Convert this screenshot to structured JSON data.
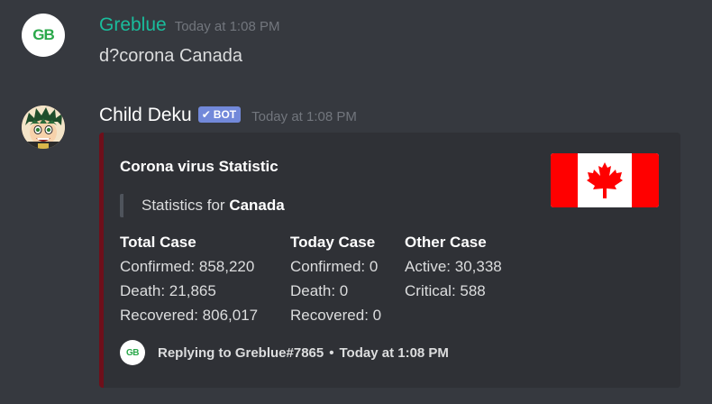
{
  "messages": [
    {
      "username": "Greblue",
      "username_color": "#1abc9c",
      "timestamp": "Today at 1:08 PM",
      "content": "d?corona Canada",
      "avatar_text": "GB"
    },
    {
      "username": "Child Deku",
      "username_color": "#ffffff",
      "bot_tag": "BOT",
      "timestamp": "Today at 1:08 PM",
      "avatar_icon": "deku-avatar-icon",
      "embed": {
        "border_color": "#6e0f1a",
        "title": "Corona virus Statistic",
        "description_prefix": "Statistics for ",
        "description_country": "Canada",
        "thumbnail_icon": "canada-flag-icon",
        "fields": [
          {
            "name": "Total Case",
            "lines": [
              "Confirmed: 858,220",
              "Death: 21,865",
              "Recovered: 806,017"
            ]
          },
          {
            "name": "Today Case",
            "lines": [
              "Confirmed: 0",
              "Death: 0",
              "Recovered: 0"
            ]
          },
          {
            "name": "Other Case",
            "lines": [
              "Active: 30,338",
              "Critical: 588"
            ]
          }
        ],
        "footer": {
          "icon_text": "GB",
          "reply_text": "Replying to Greblue#7865",
          "separator": "•",
          "timestamp": "Today at 1:08 PM"
        }
      }
    }
  ]
}
